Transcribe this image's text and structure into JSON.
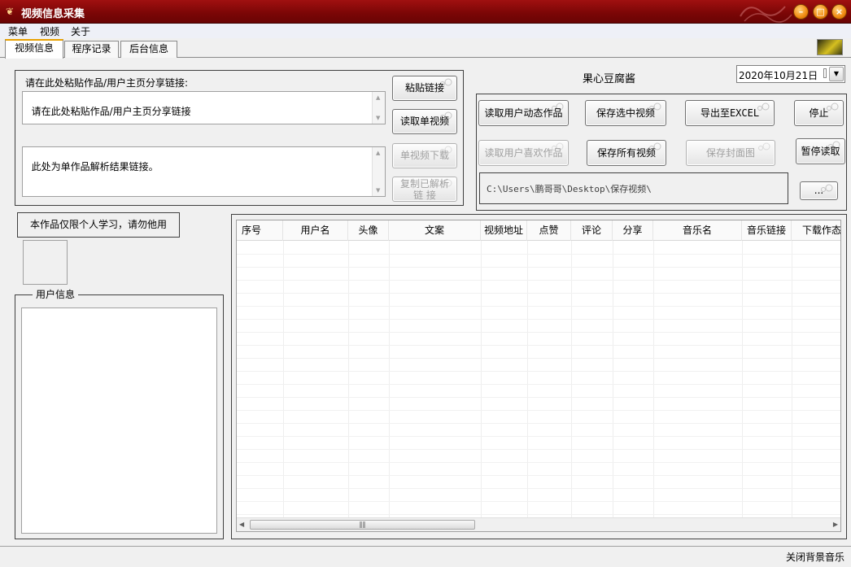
{
  "window": {
    "title": "视频信息采集",
    "app_icon": "app-logo-icon"
  },
  "menu": [
    "菜单",
    "视频",
    "关于"
  ],
  "tabs": [
    "视频信息",
    "程序记录",
    "后台信息"
  ],
  "share_link": {
    "label": "请在此处粘贴作品/用户主页分享链接:",
    "input_value": "请在此处粘贴作品/用户主页分享链接",
    "result_value": "此处为单作品解析结果链接。"
  },
  "buttons": {
    "paste_link": "粘贴链接",
    "read_single_video": "读取单视频",
    "single_video_download": "单视频下载",
    "copy_parsed_link": "复制已解析\n链 接",
    "read_user_works": "读取用户动态作品",
    "save_selected_video": "保存选中视频",
    "export_excel": "导出至EXCEL",
    "stop": "停止",
    "read_user_likes": "读取用户喜欢作品",
    "save_all_videos": "保存所有视频",
    "save_cover": "保存封面图",
    "pause_read": "暂停读取",
    "browse": "..."
  },
  "username_display": "果心豆腐酱",
  "date_picker": {
    "value": "2020年10月21日"
  },
  "save_path": "C:\\Users\\鹏哥哥\\Desktop\\保存视频\\",
  "notice": "本作品仅限个人学习，请勿他用",
  "user_info": {
    "title": "用户信息"
  },
  "table": {
    "columns": [
      "序号",
      "用户名",
      "头像",
      "文案",
      "视频地址",
      "点赞",
      "评论",
      "分享",
      "音乐名",
      "音乐链接",
      "下载作态"
    ],
    "rows": []
  },
  "status": {
    "music_toggle": "关闭背景音乐"
  }
}
